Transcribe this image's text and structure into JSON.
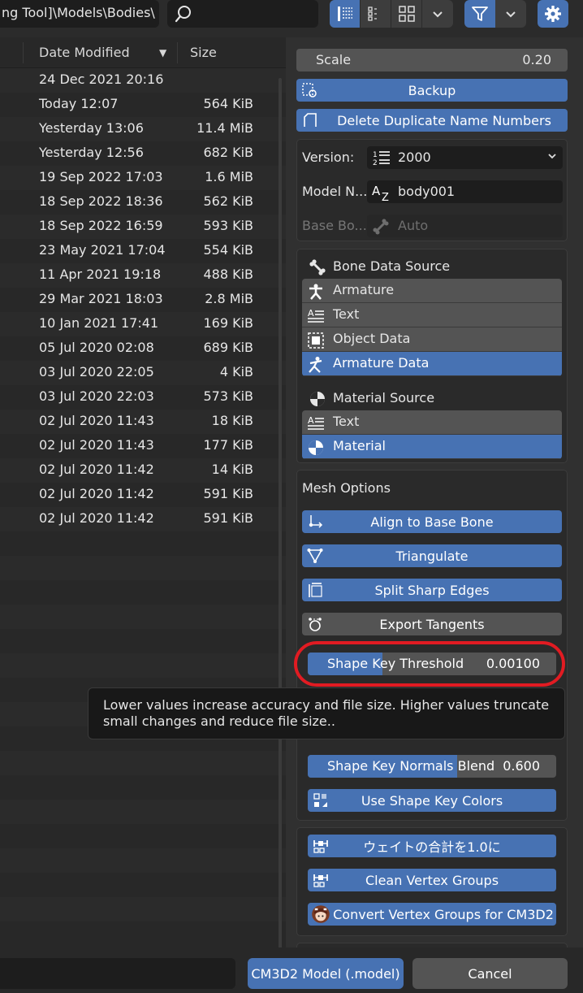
{
  "topbar": {
    "path": "ng Tool]\\Models\\Bodies\\",
    "search_value": ""
  },
  "filelist": {
    "columns": {
      "date": "Date Modified",
      "size": "Size",
      "sort_indicator": "▼"
    },
    "rows": [
      {
        "date": "24 Dec 2021 20:16",
        "size": ""
      },
      {
        "date": "Today 12:07",
        "size": "564 KiB"
      },
      {
        "date": "Yesterday 13:06",
        "size": "11.4 MiB"
      },
      {
        "date": "Yesterday 12:56",
        "size": "682 KiB"
      },
      {
        "date": "19 Sep 2022 17:03",
        "size": "1.6 MiB"
      },
      {
        "date": "18 Sep 2022 18:36",
        "size": "562 KiB"
      },
      {
        "date": "18 Sep 2022 16:59",
        "size": "593 KiB"
      },
      {
        "date": "23 May 2021 17:04",
        "size": "554 KiB"
      },
      {
        "date": "11 Apr 2021 19:18",
        "size": "488 KiB"
      },
      {
        "date": "29 Mar 2021 18:03",
        "size": "2.8 MiB"
      },
      {
        "date": "10 Jan 2021 17:41",
        "size": "169 KiB"
      },
      {
        "date": "05 Jul 2020 02:08",
        "size": "689 KiB"
      },
      {
        "date": "03 Jul 2020 22:05",
        "size": "4 KiB"
      },
      {
        "date": "03 Jul 2020 22:03",
        "size": "573 KiB"
      },
      {
        "date": "02 Jul 2020 11:43",
        "size": "18 KiB"
      },
      {
        "date": "02 Jul 2020 11:43",
        "size": "177 KiB"
      },
      {
        "date": "02 Jul 2020 11:42",
        "size": "14 KiB"
      },
      {
        "date": "02 Jul 2020 11:42",
        "size": "591 KiB"
      },
      {
        "date": "02 Jul 2020 11:42",
        "size": "591 KiB"
      }
    ]
  },
  "panel": {
    "scale": {
      "label": "Scale",
      "value": "0.20"
    },
    "backup_label": "Backup",
    "delete_dup_label": "Delete Duplicate Name Numbers",
    "version": {
      "label": "Version:",
      "value": "2000"
    },
    "model_name": {
      "label": "Model N...",
      "value": "body001"
    },
    "base_bone": {
      "label": "Base Bo...",
      "value": "Auto"
    },
    "bone_source": {
      "title": "Bone Data Source",
      "items": [
        "Armature",
        "Text",
        "Object Data",
        "Armature Data"
      ],
      "selected": 3
    },
    "material_source": {
      "title": "Material Source",
      "items": [
        "Text",
        "Material"
      ],
      "selected": 1
    },
    "mesh_options": {
      "title": "Mesh Options",
      "align_label": "Align to Base Bone",
      "triangulate_label": "Triangulate",
      "split_label": "Split Sharp Edges",
      "export_tangents_label": "Export Tangents",
      "shape_key_threshold": {
        "label": "Shape Key Threshold",
        "value": "0.00100",
        "fill": 0.3
      },
      "shape_key_normals_blend": {
        "label": "Shape Key Normals Blend",
        "value": "0.600",
        "fill": 0.6
      },
      "use_shape_key_colors_label": "Use Shape Key Colors"
    },
    "vertex_groups": {
      "normalize_label": "ウェイトの合計を1.0に",
      "clean_label": "Clean Vertex Groups",
      "convert_label": "Convert Vertex Groups for CM3D2"
    },
    "tooltip_text": "Lower values increase accuracy and file size. Higher values truncate small changes and reduce file size.."
  },
  "bottombar": {
    "filename_value": "",
    "confirm_label": "CM3D2 Model (.model)",
    "cancel_label": "Cancel"
  },
  "colors": {
    "accent": "#4772b3",
    "highlight_circle": "#e11b22"
  }
}
